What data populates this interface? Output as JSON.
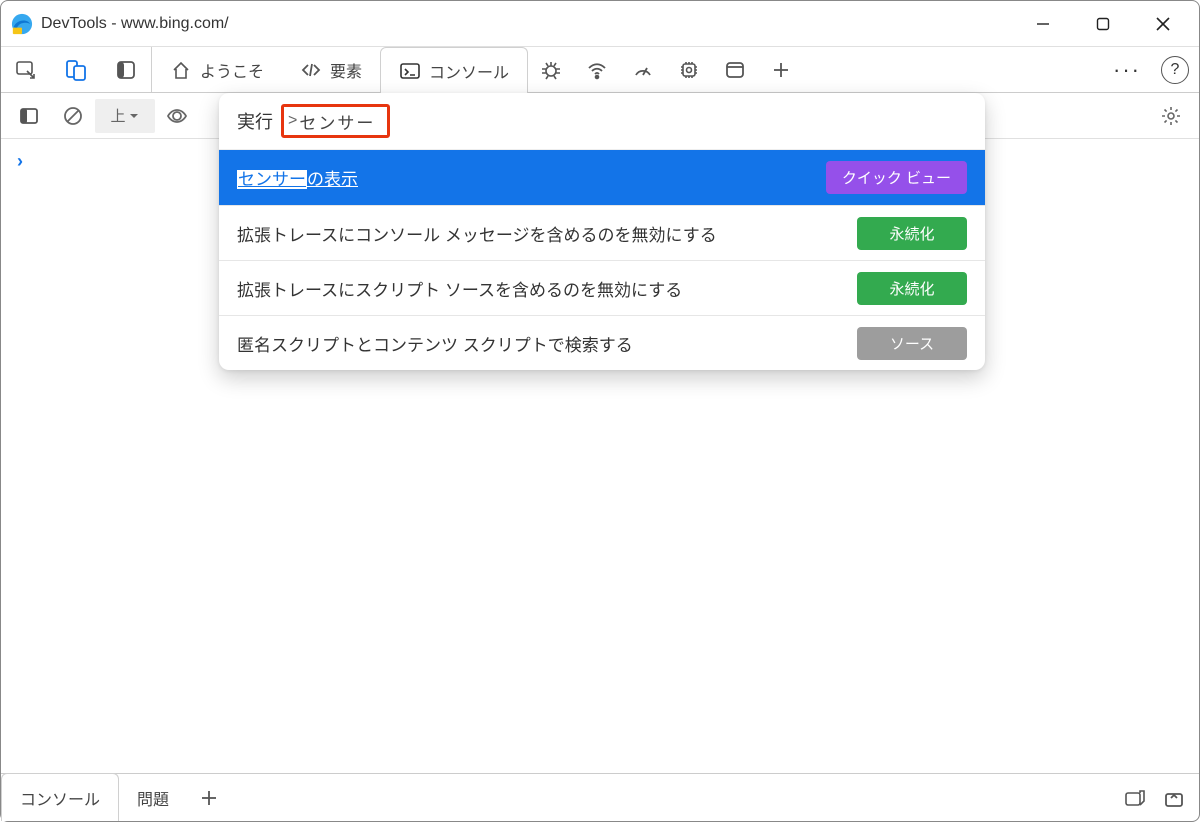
{
  "window": {
    "title": "DevTools - www.bing.com/"
  },
  "tabs": {
    "welcome": "ようこそ",
    "elements": "要素",
    "console": "コンソール"
  },
  "secondbar": {
    "context": "上"
  },
  "command_menu": {
    "run_label": "実行",
    "input_prefix": ">",
    "input_value": "センサー",
    "items": [
      {
        "label_pre": "",
        "label_match": "センサー",
        "label_post": "の表示",
        "badge": "クイック ビュー",
        "badge_color": "purple"
      },
      {
        "label_pre": "拡張トレースにコンソール メッセージを含めるのを無効にする",
        "label_match": "",
        "label_post": "",
        "badge": "永続化",
        "badge_color": "green"
      },
      {
        "label_pre": "拡張トレースにスクリプト ソースを含めるのを無効にする",
        "label_match": "",
        "label_post": "",
        "badge": "永続化",
        "badge_color": "green"
      },
      {
        "label_pre": "匿名スクリプトとコンテンツ スクリプトで検索する",
        "label_match": "",
        "label_post": "",
        "badge": "ソース",
        "badge_color": "gray"
      }
    ]
  },
  "drawer": {
    "console": "コンソール",
    "issues": "問題"
  }
}
